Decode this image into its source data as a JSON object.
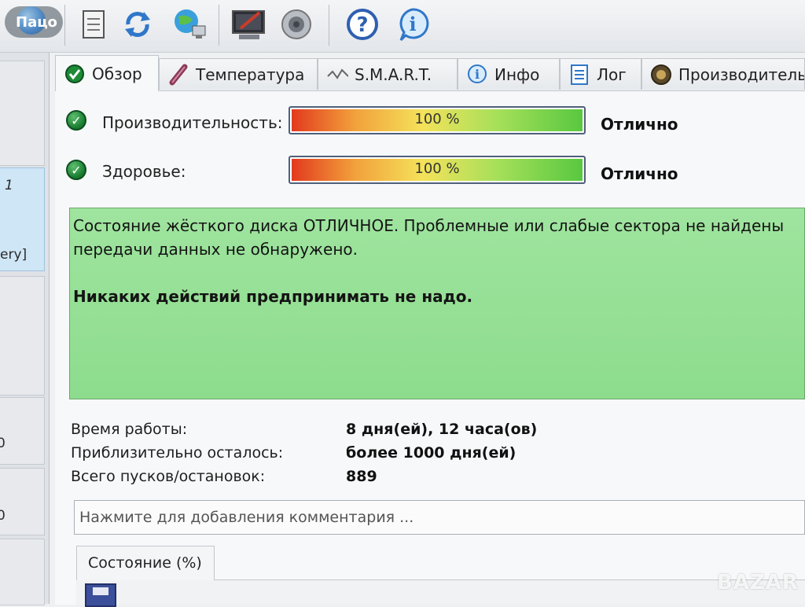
{
  "user": {
    "name": "Пацо"
  },
  "toolbar": {
    "icons": [
      "avatar-globe-icon",
      "document-icon",
      "refresh-icon",
      "network-globe-icon",
      "monitor-icon",
      "speaker-icon",
      "help-icon",
      "info-icon"
    ]
  },
  "left_panel": {
    "selected_number": "1",
    "selected_caption": "ery]",
    "tile_a": "0",
    "tile_b": "0"
  },
  "tabs": [
    {
      "label": "Обзор",
      "icon": "check-icon",
      "active": true
    },
    {
      "label": "Температура",
      "icon": "thermometer-icon",
      "active": false
    },
    {
      "label": "S.M.A.R.T.",
      "icon": "smart-icon",
      "active": false
    },
    {
      "label": "Инфо",
      "icon": "info-icon",
      "active": false
    },
    {
      "label": "Лог",
      "icon": "log-icon",
      "active": false
    },
    {
      "label": "Производитель",
      "icon": "performance-icon",
      "active": false
    }
  ],
  "performance": {
    "label": "Производительность:",
    "percent_text": "100 %",
    "percent": 100,
    "rating": "Отлично"
  },
  "health": {
    "label": "Здоровье:",
    "percent_text": "100 %",
    "percent": 100,
    "rating": "Отлично"
  },
  "message": {
    "line1": "Состояние жёсткого диска ОТЛИЧНОЕ. Проблемные или слабые сектора не найдены",
    "line2": "передачи данных не обнаружено.",
    "advice": "Никаких действий предпринимать не надо."
  },
  "info": {
    "uptime_label": "Время работы:",
    "uptime_value": "8 дня(ей), 12 часа(ов)",
    "remaining_label": "Приблизительно осталось:",
    "remaining_value": "более 1000 дня(ей)",
    "starts_label": "Всего пусков/остановок:",
    "starts_value": "889"
  },
  "comment": {
    "placeholder": "Нажмите для добавления комментария ..."
  },
  "bottom_tab": {
    "label": "Состояние (%)"
  },
  "watermark": "BAZAR",
  "colors": {
    "healthy_green": "#8ddc8d",
    "check_green": "#167a2e",
    "bar_red": "#e23a1e",
    "bar_green": "#58c840"
  }
}
